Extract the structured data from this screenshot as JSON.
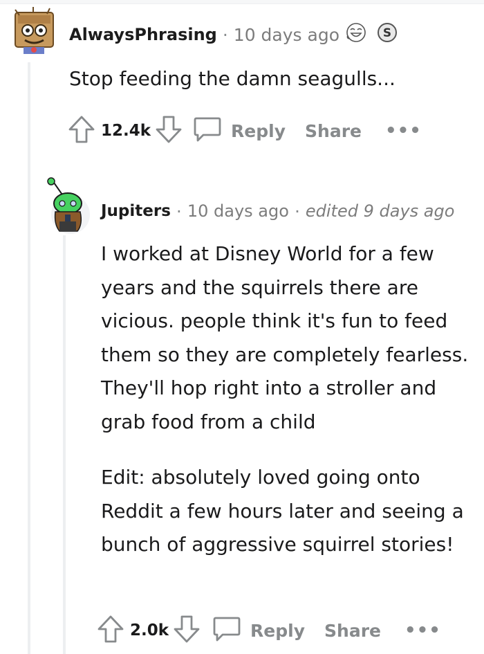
{
  "comments": [
    {
      "author": "AlwaysPhrasing",
      "time": "10 days ago",
      "body": [
        "Stop feeding the damn seagulls..."
      ],
      "score": "12.4k",
      "actions": {
        "reply": "Reply",
        "share": "Share",
        "more": "•••"
      },
      "awards": [
        "laughing-face-award",
        "silver-coin-award"
      ]
    },
    {
      "author": "Jupiters",
      "time": "10 days ago",
      "edited": "edited 9 days ago",
      "body": [
        "I worked at Disney World for a few years and the squirrels there are vicious. people think it's fun to feed them so they are completely fearless. They'll hop right into a stroller and grab food from a child",
        "Edit: absolutely loved going onto Reddit a few hours later and seeing a bunch of aggressive squirrel stories!"
      ],
      "score": "2.0k",
      "actions": {
        "reply": "Reply",
        "share": "Share",
        "more": "•••"
      }
    }
  ],
  "separator": "·",
  "colors": {
    "text": "#1a1a1b",
    "muted": "#878a8c",
    "thread_line": "#edeff1",
    "avatar_green": "#46d160"
  }
}
